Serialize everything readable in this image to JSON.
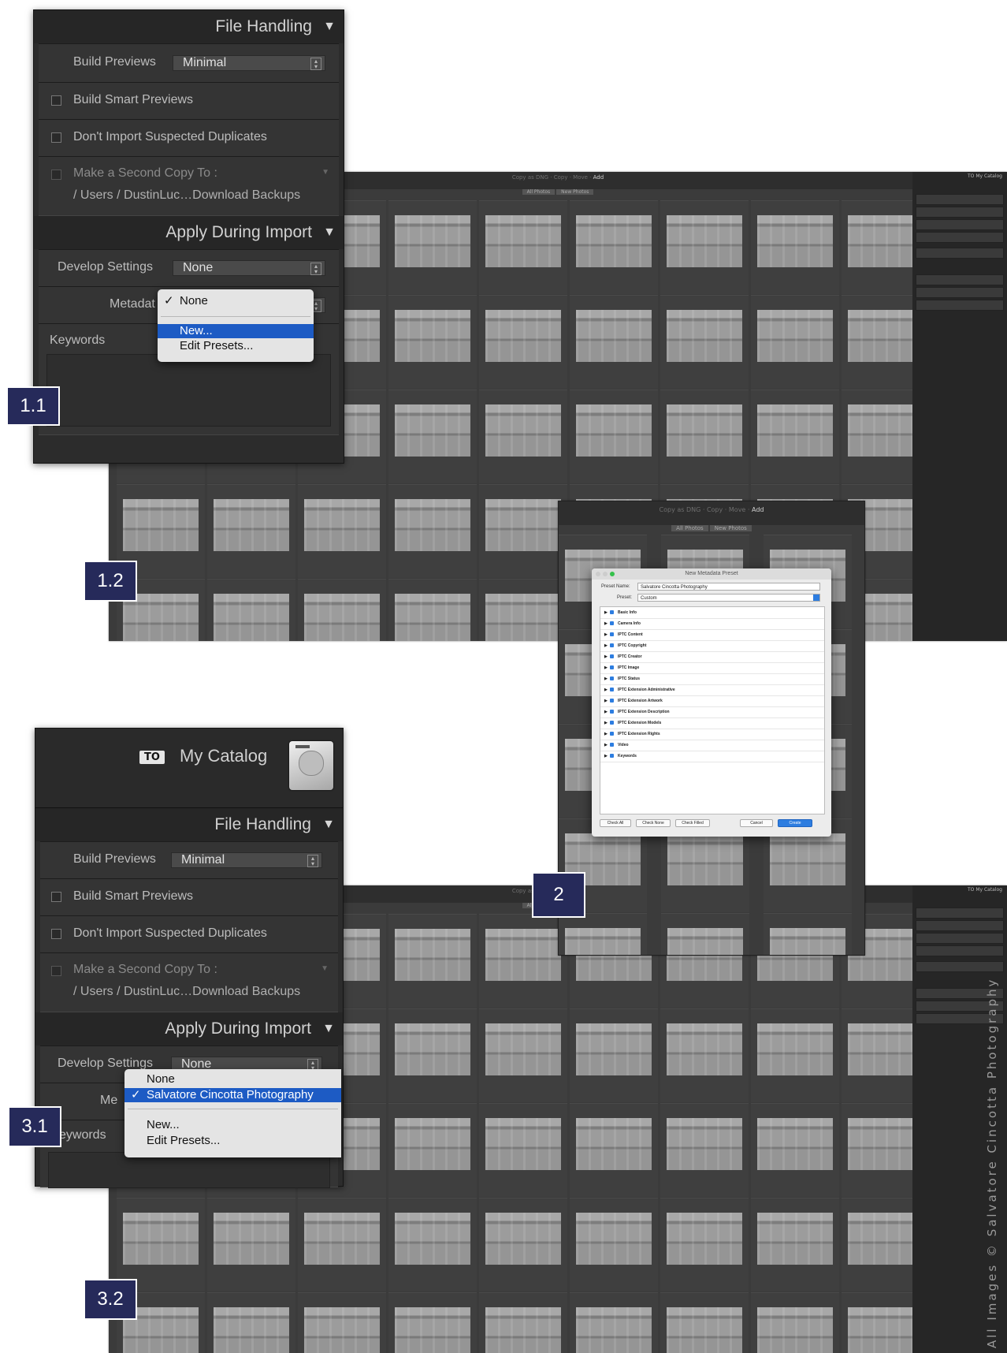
{
  "screen1": {
    "modes": {
      "copy_dng": "Copy as DNG",
      "copy": "Copy",
      "move": "Move",
      "add": "Add"
    },
    "filters": [
      "All Photos",
      "New Photos"
    ],
    "catalog_badge": "TO",
    "catalog": "My Catalog"
  },
  "panel1": {
    "file_handling": "File Handling",
    "build_previews_label": "Build Previews",
    "build_previews_value": "Minimal",
    "build_smart_previews": "Build Smart Previews",
    "dont_import_duplicates": "Don't Import Suspected Duplicates",
    "second_copy": "Make a Second Copy To :",
    "second_copy_path": "/ Users / DustinLuc…Download Backups",
    "apply_during_import": "Apply During Import",
    "develop_settings_label": "Develop Settings",
    "develop_settings_value": "None",
    "metadata_label": "Metadat",
    "keywords": "Keywords",
    "menu": {
      "none": "None",
      "new": "New...",
      "edit_presets": "Edit Presets..."
    }
  },
  "dialog": {
    "title": "New Metadata Preset",
    "preset_name_label": "Preset Name:",
    "preset_name_value": "Salvatore Cincotta Photography",
    "preset_label": "Preset:",
    "preset_value": "Custom",
    "groups": [
      "Basic Info",
      "Camera Info",
      "IPTC Content",
      "IPTC Copyright",
      "IPTC Creator",
      "IPTC Image",
      "IPTC Status",
      "IPTC Extension Administrative",
      "IPTC Extension Artwork",
      "IPTC Extension Description",
      "IPTC Extension Models",
      "IPTC Extension Rights",
      "Video",
      "Keywords"
    ],
    "buttons": {
      "check_all": "Check All",
      "check_none": "Check None",
      "check_filled": "Check Filled",
      "cancel": "Cancel",
      "create": "Create"
    }
  },
  "panel3": {
    "catalog_badge": "TO",
    "catalog": "My Catalog",
    "file_handling": "File Handling",
    "build_previews_label": "Build Previews",
    "build_previews_value": "Minimal",
    "build_smart_previews": "Build Smart Previews",
    "dont_import_duplicates": "Don't Import Suspected Duplicates",
    "second_copy": "Make a Second Copy To :",
    "second_copy_path": "/ Users / DustinLuc…Download Backups",
    "apply_during_import": "Apply During Import",
    "develop_settings_label": "Develop Settings",
    "develop_settings_value": "None",
    "metadata_label": "Me",
    "keywords": "eywords",
    "menu": {
      "none": "None",
      "selected": "Salvatore Cincotta Photography",
      "new": "New...",
      "edit_presets": "Edit Presets..."
    }
  },
  "step_labels": {
    "s11": "1.1",
    "s12": "1.2",
    "s2": "2",
    "s31": "3.1",
    "s32": "3.2"
  },
  "credit": "All Images © Salvatore Cincotta Photography"
}
